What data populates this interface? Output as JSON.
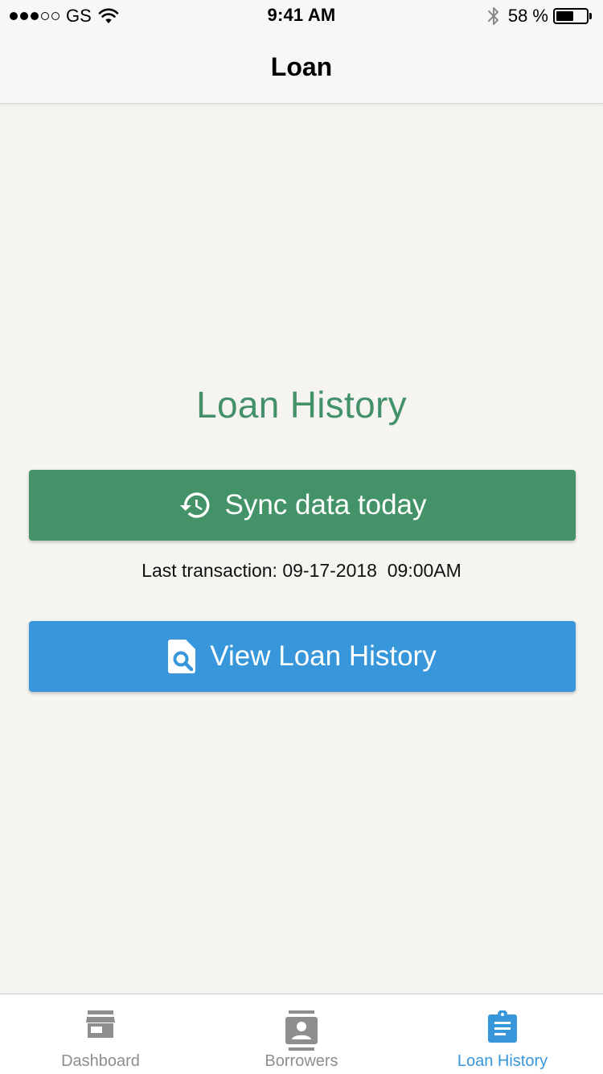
{
  "status_bar": {
    "signal_bars": 5,
    "signal_filled": 3,
    "carrier": "GS",
    "time": "9:41 AM",
    "battery_percent_label": "58 %",
    "battery_level": 0.58
  },
  "nav": {
    "title": "Loan"
  },
  "main": {
    "title": "Loan History",
    "sync_button_label": "Sync data today",
    "last_transaction": "Last transaction: 09-17-2018  09:00AM",
    "view_button_label": "View Loan History"
  },
  "tabs": [
    {
      "label": "Dashboard",
      "icon": "store-icon",
      "active": false
    },
    {
      "label": "Borrowers",
      "icon": "contact-icon",
      "active": false
    },
    {
      "label": "Loan History",
      "icon": "clipboard-icon",
      "active": true
    }
  ],
  "colors": {
    "green": "#449368",
    "blue": "#3897db",
    "inactive_tab": "#8e8e8e",
    "background": "#f5f4f0"
  }
}
